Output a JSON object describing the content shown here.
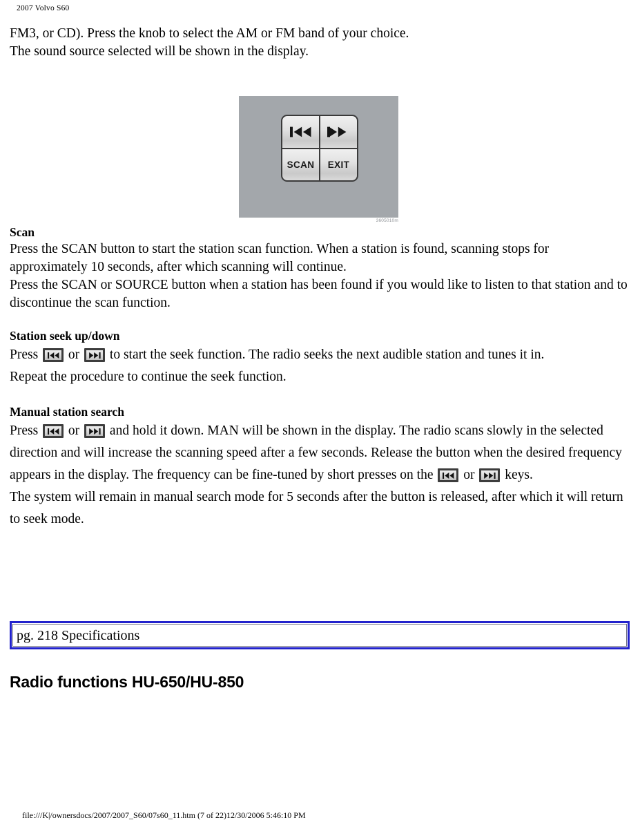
{
  "header": {
    "running_title": "2007 Volvo S60"
  },
  "body": {
    "intro_line1": "FM3, or CD). Press the knob to select the AM or FM band of your choice.",
    "intro_line2": "The sound source selected will be shown in the display."
  },
  "figure": {
    "keys": {
      "seek_down": "seek-down-icon",
      "seek_up": "seek-up-icon",
      "scan": "SCAN",
      "exit": "EXIT"
    },
    "caption": "3605010m"
  },
  "sections": [
    {
      "heading": "Scan",
      "paragraph1": "Press the SCAN button to start the station scan function. When a station is found, scanning stops for approximately 10 seconds, after which scanning will continue.",
      "paragraph2": "Press the SCAN or SOURCE button when a station has been found if you would like to listen to that station and to discontinue the scan function."
    },
    {
      "heading": "Station seek up/down",
      "text_a": "Press",
      "text_or": "or",
      "text_b": "to start the seek function. The radio seeks the next audible station and tunes it in.",
      "text_c": "Repeat the procedure to continue the seek function."
    },
    {
      "heading": "Manual station search",
      "text_a": "Press",
      "text_or": "or",
      "text_b": "and hold it down. MAN will be shown in the display. The radio scans slowly in the selected direction and will increase the scanning speed after a few seconds. Release the button when the desired frequency appears in the display. The frequency can be fine-tuned by short presses on the",
      "text_or2": "or",
      "text_c": "keys.",
      "text_d": "The system will remain in manual search mode for 5 seconds after the button is released, after which it will return to seek mode."
    }
  ],
  "link_box": {
    "label": "pg. 218 Specifications",
    "border_color": "#2222cc"
  },
  "main_heading": "Radio functions HU-650/HU-850",
  "footer": {
    "path": "file:///K|/ownersdocs/2007/2007_S60/07s60_11.htm (7 of 22)12/30/2006 5:46:10 PM"
  }
}
